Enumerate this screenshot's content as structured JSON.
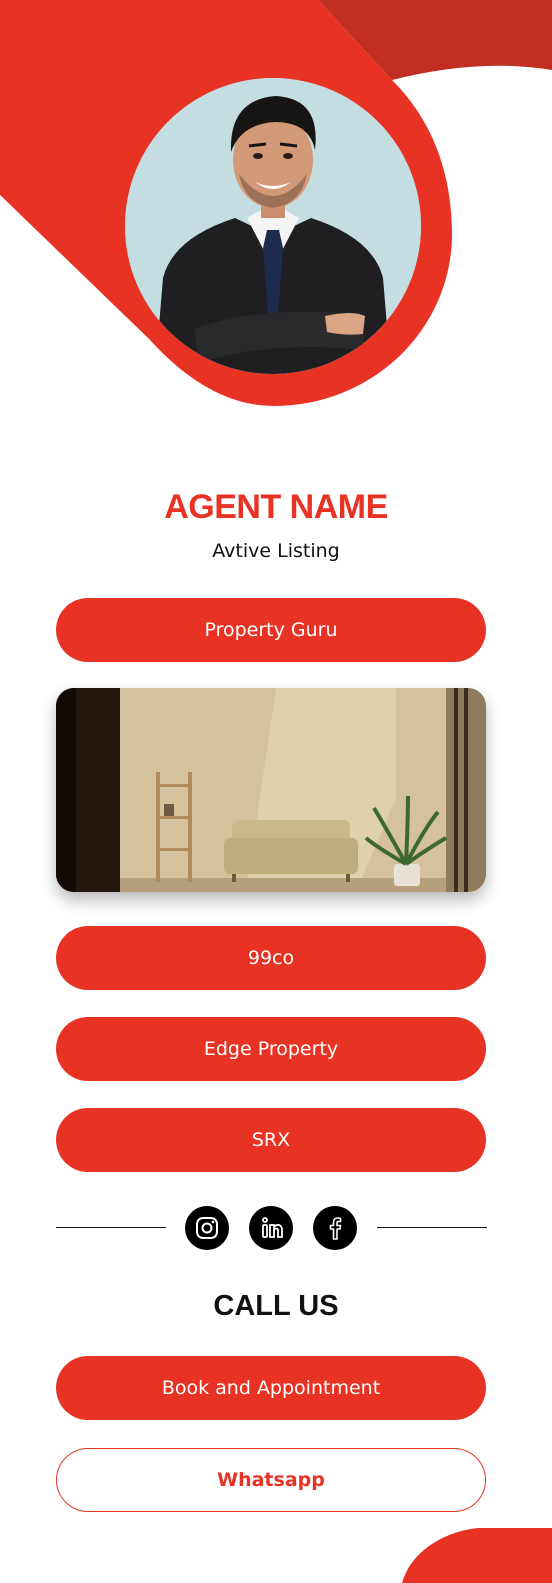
{
  "theme": {
    "accent": "#e83224",
    "accent_dark": "#c22f22",
    "text": "#111111"
  },
  "profile": {
    "agent_name": "AGENT NAME",
    "subtitle": "Avtive Listing"
  },
  "links": {
    "property_guru": "Property Guru",
    "nine_nine_co": "99co",
    "edge_property": "Edge Property",
    "srx": "SRX"
  },
  "social": {
    "icons": [
      "instagram-icon",
      "linkedin-icon",
      "facebook-icon"
    ]
  },
  "contact": {
    "heading": "CALL US",
    "book_label": "Book and Appointment",
    "whatsapp_label": "Whatsapp"
  }
}
